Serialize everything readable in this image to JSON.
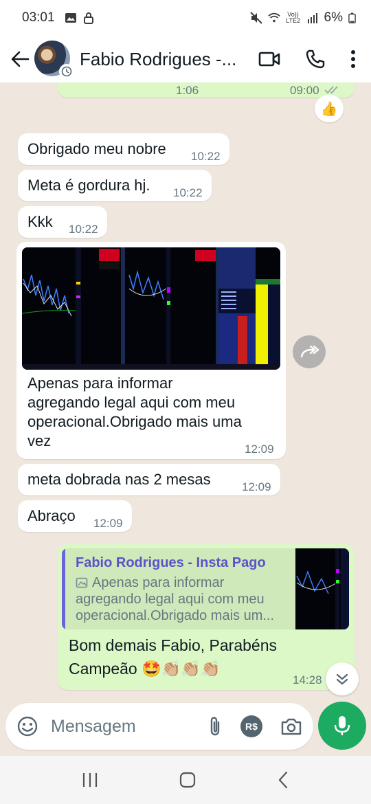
{
  "status_bar": {
    "time": "03:01",
    "network_label": "Vo)) LTE2",
    "battery": "6%"
  },
  "header": {
    "contact_name": "Fabio Rodrigues -..."
  },
  "chat": {
    "top_partial": {
      "left_time": "1:06",
      "right_time": "09:00"
    },
    "reaction_emoji": "👍",
    "messages": [
      {
        "text": "Obrigado meu nobre",
        "time": "10:22"
      },
      {
        "text": "Meta é gordura hj.",
        "time": "10:22"
      },
      {
        "text": "Kkk",
        "time": "10:22"
      },
      {
        "caption_lines": [
          "Apenas para informar",
          "agregando legal aqui com meu",
          "operacional.Obrigado mais uma",
          "vez"
        ],
        "time": "12:09"
      },
      {
        "text": "meta dobrada nas 2 mesas",
        "time": "12:09"
      },
      {
        "text": "Abraço",
        "time": "12:09"
      }
    ],
    "reply": {
      "quote_author": "Fabio Rodrigues - Insta Pago",
      "quote_lines": [
        "Apenas para informar",
        "agregando legal aqui com meu",
        "operacional.Obrigado mais um..."
      ],
      "text_line1": "Bom demais Fabio, Parabéns",
      "text_line2": "Campeão 🤩👏🏼👏🏼👏🏼",
      "time": "14:28"
    }
  },
  "input": {
    "placeholder": "Mensagem",
    "currency_label": "R$"
  },
  "colors": {
    "chat_bg": "#efe7de",
    "outgoing_bubble": "#dbf8c6",
    "mic_button": "#1daa61",
    "quote_author": "#5b52c9"
  }
}
